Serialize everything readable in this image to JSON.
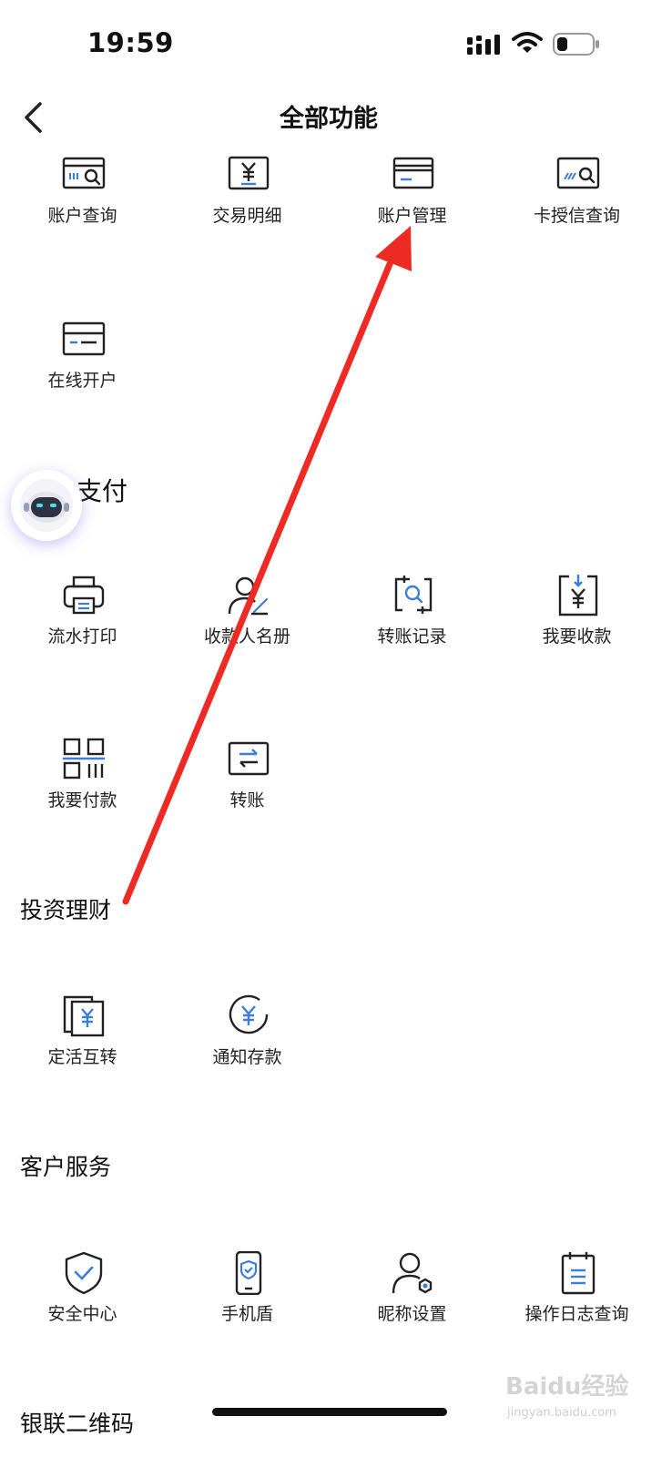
{
  "status_bar": {
    "time": "19:59",
    "signal_icon": "signal-icon",
    "wifi_icon": "wifi-icon",
    "battery_icon": "battery-icon"
  },
  "nav": {
    "title": "全部功能",
    "back_icon": "chevron-left-icon"
  },
  "sections": {
    "account": {
      "items": [
        {
          "label": "账户查询",
          "icon": "account-query-icon"
        },
        {
          "label": "交易明细",
          "icon": "transaction-detail-icon"
        },
        {
          "label": "账户管理",
          "icon": "account-manage-icon"
        },
        {
          "label": "卡授信查询",
          "icon": "card-credit-query-icon"
        },
        {
          "label": "在线开户",
          "icon": "open-account-icon"
        }
      ]
    },
    "payment": {
      "title_visible": "支付",
      "items": [
        {
          "label": "流水打印",
          "icon": "printer-icon"
        },
        {
          "label": "收款人名册",
          "icon": "payee-list-icon"
        },
        {
          "label": "转账记录",
          "icon": "transfer-record-icon"
        },
        {
          "label": "我要收款",
          "icon": "receive-money-icon"
        },
        {
          "label": "我要付款",
          "icon": "pay-code-icon"
        },
        {
          "label": "转账",
          "icon": "transfer-icon"
        }
      ]
    },
    "invest": {
      "title": "投资理财",
      "items": [
        {
          "label": "定活互转",
          "icon": "fixed-current-transfer-icon"
        },
        {
          "label": "通知存款",
          "icon": "notice-deposit-icon"
        }
      ]
    },
    "service": {
      "title": "客户服务",
      "items": [
        {
          "label": "安全中心",
          "icon": "shield-icon"
        },
        {
          "label": "手机盾",
          "icon": "phone-shield-icon"
        },
        {
          "label": "昵称设置",
          "icon": "nickname-settings-icon"
        },
        {
          "label": "操作日志查询",
          "icon": "operation-log-icon"
        }
      ]
    },
    "unionpay": {
      "title": "银联二维码"
    }
  },
  "assistant": {
    "icon": "robot-assistant-icon"
  },
  "watermark": {
    "main": "Baidu经验",
    "sub": "jingyan.baidu.com"
  },
  "colors": {
    "accent_blue": "#3b7ddd",
    "icon_stroke": "#222222",
    "arrow_red": "#ee2a24"
  }
}
